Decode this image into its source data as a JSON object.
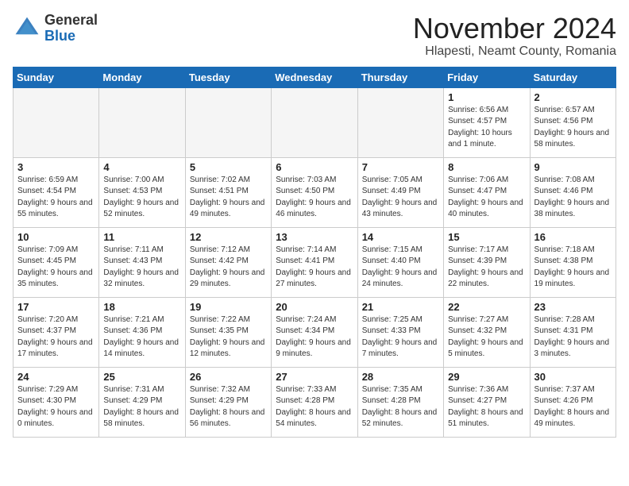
{
  "logo": {
    "general": "General",
    "blue": "Blue"
  },
  "header": {
    "month": "November 2024",
    "location": "Hlapesti, Neamt County, Romania"
  },
  "weekdays": [
    "Sunday",
    "Monday",
    "Tuesday",
    "Wednesday",
    "Thursday",
    "Friday",
    "Saturday"
  ],
  "weeks": [
    [
      {
        "day": "",
        "info": ""
      },
      {
        "day": "",
        "info": ""
      },
      {
        "day": "",
        "info": ""
      },
      {
        "day": "",
        "info": ""
      },
      {
        "day": "",
        "info": ""
      },
      {
        "day": "1",
        "info": "Sunrise: 6:56 AM\nSunset: 4:57 PM\nDaylight: 10 hours and 1 minute."
      },
      {
        "day": "2",
        "info": "Sunrise: 6:57 AM\nSunset: 4:56 PM\nDaylight: 9 hours and 58 minutes."
      }
    ],
    [
      {
        "day": "3",
        "info": "Sunrise: 6:59 AM\nSunset: 4:54 PM\nDaylight: 9 hours and 55 minutes."
      },
      {
        "day": "4",
        "info": "Sunrise: 7:00 AM\nSunset: 4:53 PM\nDaylight: 9 hours and 52 minutes."
      },
      {
        "day": "5",
        "info": "Sunrise: 7:02 AM\nSunset: 4:51 PM\nDaylight: 9 hours and 49 minutes."
      },
      {
        "day": "6",
        "info": "Sunrise: 7:03 AM\nSunset: 4:50 PM\nDaylight: 9 hours and 46 minutes."
      },
      {
        "day": "7",
        "info": "Sunrise: 7:05 AM\nSunset: 4:49 PM\nDaylight: 9 hours and 43 minutes."
      },
      {
        "day": "8",
        "info": "Sunrise: 7:06 AM\nSunset: 4:47 PM\nDaylight: 9 hours and 40 minutes."
      },
      {
        "day": "9",
        "info": "Sunrise: 7:08 AM\nSunset: 4:46 PM\nDaylight: 9 hours and 38 minutes."
      }
    ],
    [
      {
        "day": "10",
        "info": "Sunrise: 7:09 AM\nSunset: 4:45 PM\nDaylight: 9 hours and 35 minutes."
      },
      {
        "day": "11",
        "info": "Sunrise: 7:11 AM\nSunset: 4:43 PM\nDaylight: 9 hours and 32 minutes."
      },
      {
        "day": "12",
        "info": "Sunrise: 7:12 AM\nSunset: 4:42 PM\nDaylight: 9 hours and 29 minutes."
      },
      {
        "day": "13",
        "info": "Sunrise: 7:14 AM\nSunset: 4:41 PM\nDaylight: 9 hours and 27 minutes."
      },
      {
        "day": "14",
        "info": "Sunrise: 7:15 AM\nSunset: 4:40 PM\nDaylight: 9 hours and 24 minutes."
      },
      {
        "day": "15",
        "info": "Sunrise: 7:17 AM\nSunset: 4:39 PM\nDaylight: 9 hours and 22 minutes."
      },
      {
        "day": "16",
        "info": "Sunrise: 7:18 AM\nSunset: 4:38 PM\nDaylight: 9 hours and 19 minutes."
      }
    ],
    [
      {
        "day": "17",
        "info": "Sunrise: 7:20 AM\nSunset: 4:37 PM\nDaylight: 9 hours and 17 minutes."
      },
      {
        "day": "18",
        "info": "Sunrise: 7:21 AM\nSunset: 4:36 PM\nDaylight: 9 hours and 14 minutes."
      },
      {
        "day": "19",
        "info": "Sunrise: 7:22 AM\nSunset: 4:35 PM\nDaylight: 9 hours and 12 minutes."
      },
      {
        "day": "20",
        "info": "Sunrise: 7:24 AM\nSunset: 4:34 PM\nDaylight: 9 hours and 9 minutes."
      },
      {
        "day": "21",
        "info": "Sunrise: 7:25 AM\nSunset: 4:33 PM\nDaylight: 9 hours and 7 minutes."
      },
      {
        "day": "22",
        "info": "Sunrise: 7:27 AM\nSunset: 4:32 PM\nDaylight: 9 hours and 5 minutes."
      },
      {
        "day": "23",
        "info": "Sunrise: 7:28 AM\nSunset: 4:31 PM\nDaylight: 9 hours and 3 minutes."
      }
    ],
    [
      {
        "day": "24",
        "info": "Sunrise: 7:29 AM\nSunset: 4:30 PM\nDaylight: 9 hours and 0 minutes."
      },
      {
        "day": "25",
        "info": "Sunrise: 7:31 AM\nSunset: 4:29 PM\nDaylight: 8 hours and 58 minutes."
      },
      {
        "day": "26",
        "info": "Sunrise: 7:32 AM\nSunset: 4:29 PM\nDaylight: 8 hours and 56 minutes."
      },
      {
        "day": "27",
        "info": "Sunrise: 7:33 AM\nSunset: 4:28 PM\nDaylight: 8 hours and 54 minutes."
      },
      {
        "day": "28",
        "info": "Sunrise: 7:35 AM\nSunset: 4:28 PM\nDaylight: 8 hours and 52 minutes."
      },
      {
        "day": "29",
        "info": "Sunrise: 7:36 AM\nSunset: 4:27 PM\nDaylight: 8 hours and 51 minutes."
      },
      {
        "day": "30",
        "info": "Sunrise: 7:37 AM\nSunset: 4:26 PM\nDaylight: 8 hours and 49 minutes."
      }
    ]
  ]
}
